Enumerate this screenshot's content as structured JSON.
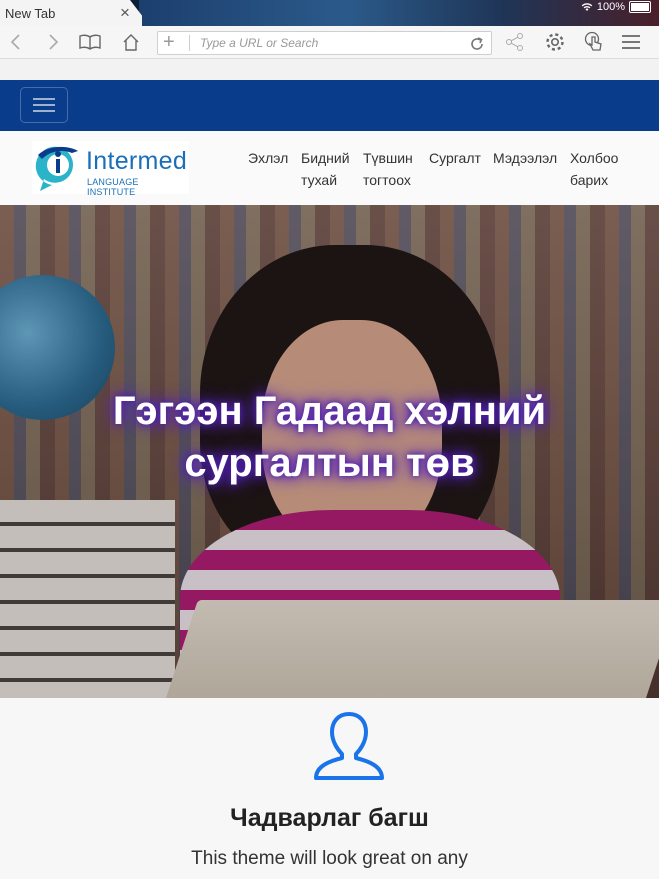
{
  "browser": {
    "tab_title": "New Tab",
    "tab_close": "×",
    "battery_percent": "100%",
    "url_placeholder": "Type a URL or Search"
  },
  "site": {
    "logo": {
      "brand": "Intermed",
      "subtitle": "LANGUAGE INSTITUTE"
    },
    "nav": [
      {
        "line1": "Эхлэл",
        "line2": ""
      },
      {
        "line1": "Бидний",
        "line2": "тухай"
      },
      {
        "line1": "Түвшин",
        "line2": "тогтоох"
      },
      {
        "line1": "Сургалт",
        "line2": ""
      },
      {
        "line1": "Мэдээлэл",
        "line2": ""
      },
      {
        "line1": "Холбоо",
        "line2": "барих"
      }
    ],
    "hero": {
      "line1": "Гэгээн Гадаад хэлний",
      "line2": "сургалтын төв"
    },
    "feature": {
      "title": "Чадварлаг багш",
      "text": "This theme will look great on any"
    }
  },
  "colors": {
    "navbar": "#0a3c8c",
    "accent": "#1a73e8",
    "hero_glow": "#4b1fa8"
  }
}
